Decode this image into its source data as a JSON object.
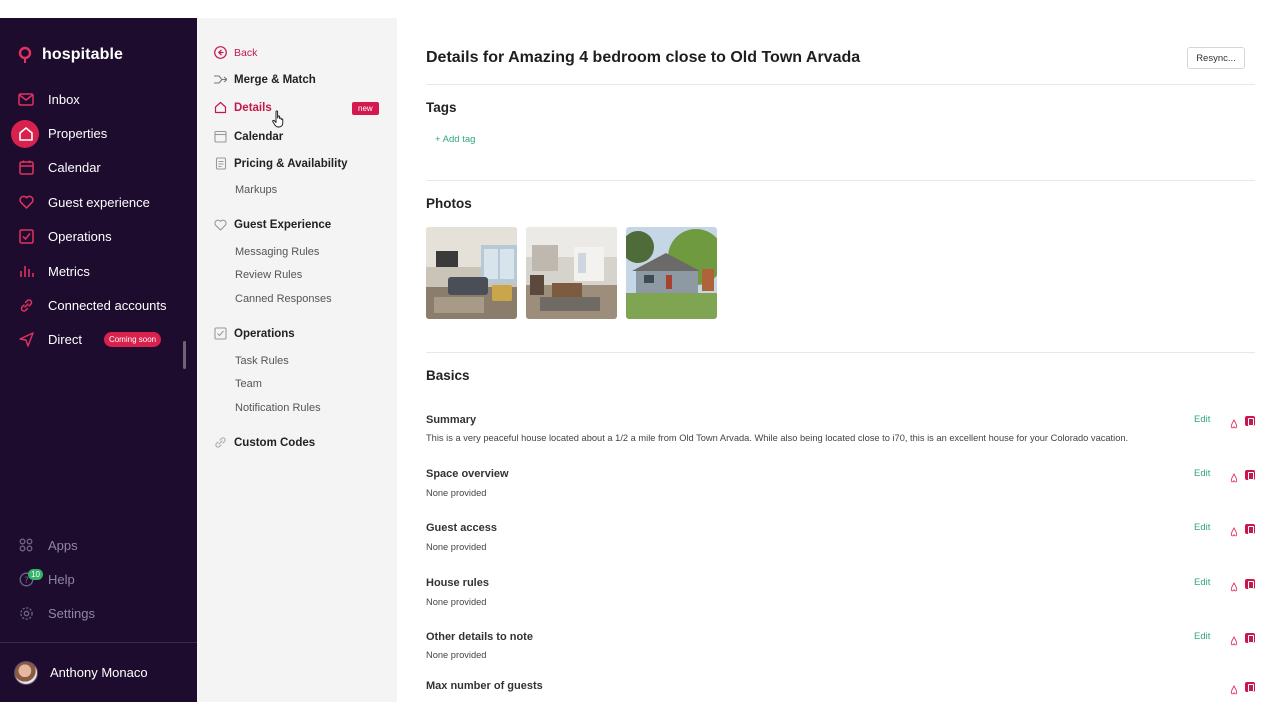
{
  "app": {
    "name": "hospitable"
  },
  "sidebar": {
    "items": [
      {
        "label": "Inbox",
        "icon": "mail-icon"
      },
      {
        "label": "Properties",
        "icon": "home-icon",
        "active": true
      },
      {
        "label": "Calendar",
        "icon": "calendar-icon"
      },
      {
        "label": "Guest experience",
        "icon": "heart-icon"
      },
      {
        "label": "Operations",
        "icon": "checkbox-icon"
      },
      {
        "label": "Metrics",
        "icon": "bar-chart-icon"
      },
      {
        "label": "Connected accounts",
        "icon": "link-icon"
      },
      {
        "label": "Direct",
        "icon": "send-icon",
        "badge": "Coming soon"
      }
    ],
    "bottom": [
      {
        "label": "Apps",
        "icon": "grid-icon"
      },
      {
        "label": "Help",
        "icon": "help-icon",
        "badge": "10"
      },
      {
        "label": "Settings",
        "icon": "gear-icon"
      }
    ],
    "user": {
      "name": "Anthony Monaco"
    }
  },
  "submenu": {
    "back": "Back",
    "merge": "Merge & Match",
    "details": "Details",
    "details_badge": "new",
    "calendar": "Calendar",
    "pricing": "Pricing & Availability",
    "markups": "Markups",
    "guest_experience": "Guest Experience",
    "messaging_rules": "Messaging Rules",
    "review_rules": "Review Rules",
    "canned_responses": "Canned Responses",
    "operations": "Operations",
    "task_rules": "Task Rules",
    "team": "Team",
    "notification_rules": "Notification Rules",
    "custom_codes": "Custom Codes"
  },
  "main": {
    "title": "Details for Amazing 4 bedroom close to Old Town Arvada",
    "resync": "Resync...",
    "tags_title": "Tags",
    "add_tag": "+ Add tag",
    "photos_title": "Photos",
    "basics_title": "Basics",
    "edit_label": "Edit",
    "fields": [
      {
        "label": "Summary",
        "value": "This is a very peaceful house located about a 1/2 a mile from Old Town Arvada. While also being located close to i70, this is an excellent house for your Colorado vacation."
      },
      {
        "label": "Space overview",
        "value": "None provided"
      },
      {
        "label": "Guest access",
        "value": "None provided"
      },
      {
        "label": "House rules",
        "value": "None provided"
      },
      {
        "label": "Other details to note",
        "value": "None provided"
      },
      {
        "label": "Max number of guests",
        "value": ""
      }
    ]
  },
  "colors": {
    "sidebar_bg": "#1e0c2f",
    "accent": "#d9214e",
    "edit_green": "#2fa87a"
  }
}
